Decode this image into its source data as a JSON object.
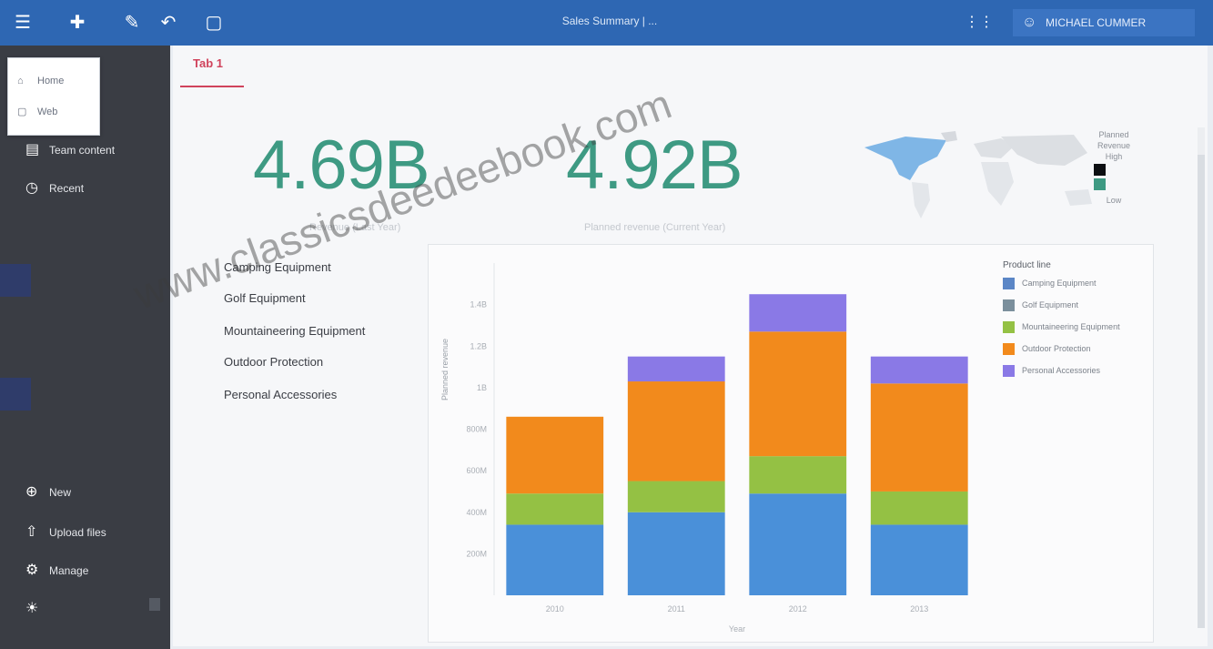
{
  "topbar": {
    "title": "Sales Summary | ...",
    "user": "MICHAEL CUMMER",
    "icons": [
      "logo-icon",
      "new-doc-icon",
      "pencil-icon",
      "undo-icon",
      "present-icon",
      "grid-icon",
      "user-icon"
    ]
  },
  "sidebar": {
    "items": [
      "Team content",
      "Recent",
      "New",
      "Upload files",
      "Manage"
    ]
  },
  "popup": {
    "items": [
      "Home",
      "Web"
    ]
  },
  "tab": {
    "label": "Tab 1"
  },
  "kpis": [
    {
      "value": "4.69B",
      "label": "Revenue (Last Year)"
    },
    {
      "value": "4.92B",
      "label": "Planned revenue (Current Year)"
    }
  ],
  "map_legend": {
    "title": "Planned Revenue",
    "high": "High",
    "low": "Low",
    "colors": {
      "high": "#0d0f12",
      "low": "#3e9a83"
    }
  },
  "category_list": [
    "Camping Equipment",
    "Golf Equipment",
    "Mountaineering Equipment",
    "Outdoor Protection",
    "Personal Accessories"
  ],
  "chart": {
    "y_axis_label": "Planned revenue",
    "x_axis_label": "Year",
    "legend_title": "Product line",
    "legend": [
      {
        "name": "Camping Equipment",
        "color": "#5b86c6"
      },
      {
        "name": "Golf Equipment",
        "color": "#7b8f9c"
      },
      {
        "name": "Mountaineering Equipment",
        "color": "#94c144"
      },
      {
        "name": "Outdoor Protection",
        "color": "#f28a1c"
      },
      {
        "name": "Personal Accessories",
        "color": "#8a79e6"
      }
    ]
  },
  "chart_data": {
    "type": "bar",
    "stacked": true,
    "categories": [
      "2010",
      "2011",
      "2012",
      "2013"
    ],
    "ylim": [
      0,
      1600
    ],
    "yticks": [
      "200M",
      "400M",
      "600M",
      "800M",
      "1B",
      "1.2B",
      "1.4B"
    ],
    "series": [
      {
        "name": "Camping Equipment",
        "color": "#4a90d9",
        "values": [
          340,
          400,
          490,
          340
        ]
      },
      {
        "name": "Golf Equipment",
        "color": "#94c144",
        "values": [
          150,
          150,
          180,
          160
        ]
      },
      {
        "name": "Outdoor Protection",
        "color": "#f28a1c",
        "values": [
          370,
          480,
          600,
          520
        ]
      },
      {
        "name": "Personal Accessories",
        "color": "#8a79e6",
        "values": [
          0,
          120,
          180,
          130
        ]
      }
    ]
  },
  "watermark": "www.classicsdeedeebook.com"
}
